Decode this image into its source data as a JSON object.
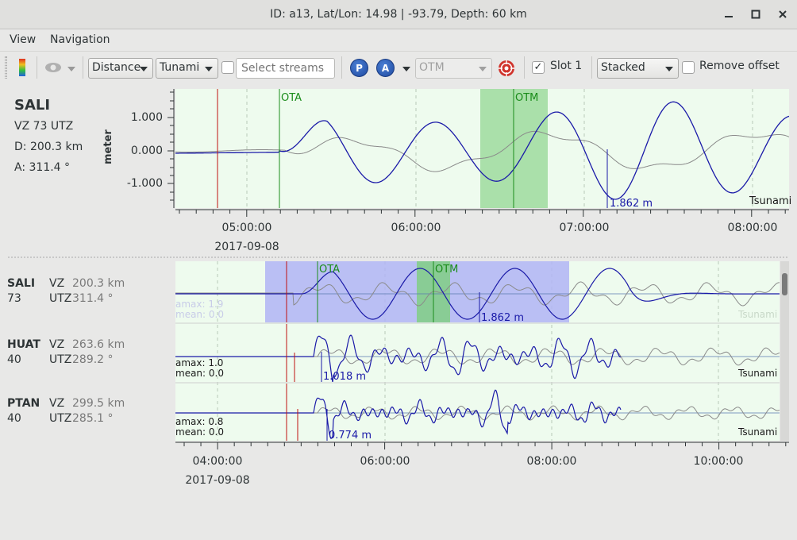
{
  "window": {
    "title": "ID: a13, Lat/Lon: 14.98 | -93.79, Depth: 60 km",
    "minimize_icon": "minimize-icon",
    "maximize_icon": "maximize-icon",
    "close_icon": "close-icon"
  },
  "menu": {
    "items": [
      "View",
      "Navigation"
    ]
  },
  "toolbar": {
    "sort_combo": "Distance",
    "filter_combo": "Tunami",
    "streams_checked": false,
    "streams_placeholder": "Select streams",
    "p_label": "P",
    "a_label": "A",
    "phase_combo": "OTM",
    "slot_checked": true,
    "slot_label": "Slot 1",
    "mode_combo": "Stacked",
    "remove_offset_checked": false,
    "remove_offset_label": "Remove offset",
    "colors": {
      "accent_blue": "#2a56b8",
      "target_red": "#d0342c"
    }
  },
  "top_panel": {
    "station": "SALI",
    "channel": "VZ 73 UTZ",
    "distance": "D:  200.3 km",
    "azimuth": "A:  311.4 °",
    "y_axis_label": "meter",
    "y_ticks": [
      "1.000",
      "0.000",
      "-1.000"
    ],
    "x_ticks": [
      "05:00:00",
      "06:00:00",
      "07:00:00",
      "08:00:00"
    ],
    "date": "2017-09-08",
    "pick_labels": [
      "OTA",
      "OTM"
    ],
    "amplitude_label": "1.862 m",
    "tag": "Tsunami"
  },
  "traces": [
    {
      "station": "SALI",
      "channel": "VZ",
      "distance": "200.3 km",
      "loc": "73",
      "net": "UTZ",
      "azimuth": "311.4 °",
      "amax": "amax: 1.9",
      "mean": "mean: 0.0",
      "amplitude": "1.862 m",
      "tag": "Tsunami",
      "picks": [
        "OTA",
        "OTM"
      ]
    },
    {
      "station": "HUAT",
      "channel": "VZ",
      "distance": "263.6 km",
      "loc": "40",
      "net": "UTZ",
      "azimuth": "289.2 °",
      "amax": "amax: 1.0",
      "mean": "mean: 0.0",
      "amplitude": "1.018 m",
      "tag": "Tsunami"
    },
    {
      "station": "PTAN",
      "channel": "VZ",
      "distance": "299.5 km",
      "loc": "40",
      "net": "UTZ",
      "azimuth": "285.1 °",
      "amax": "amax: 0.8",
      "mean": "mean: 0.0",
      "amplitude": "0.774 m",
      "tag": "Tsunami"
    }
  ],
  "bottom_axis": {
    "x_ticks": [
      "04:00:00",
      "06:00:00",
      "08:00:00",
      "10:00:00"
    ],
    "date": "2017-09-08"
  },
  "colors": {
    "plot_bg": "#eefbee",
    "trace_main": "#1a1aa8",
    "trace_ref": "#8a8a8a",
    "pick_green": "#1a8c1a",
    "origin_red": "#c01010",
    "selection_blue": "#b0b4f4",
    "selection_green": "#7dcf7d"
  }
}
